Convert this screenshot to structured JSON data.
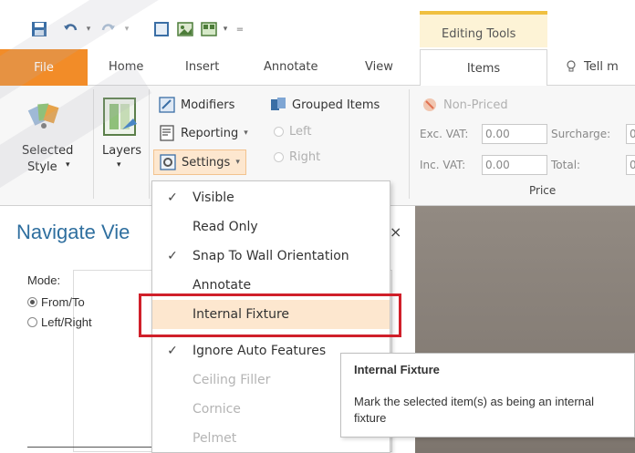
{
  "quick_access": {
    "icons": [
      "save-icon",
      "undo-icon",
      "redo-icon",
      "square-icon",
      "gallery-icon",
      "layout-icon",
      "customize-icon"
    ]
  },
  "context_tab": {
    "label": "Editing Tools"
  },
  "tabs": {
    "file": "File",
    "home": "Home",
    "insert": "Insert",
    "annotate": "Annotate",
    "view": "View",
    "items": "Items",
    "tell_me": "Tell m"
  },
  "ribbon": {
    "selected_style": "Selected",
    "selected_style2": "Style",
    "layers": "Layers",
    "modifiers": "Modifiers",
    "reporting": "Reporting",
    "settings": "Settings",
    "grouped_items": "Grouped Items",
    "left": "Left",
    "right": "Right",
    "non_priced": "Non-Priced",
    "exc_vat_label": "Exc. VAT:",
    "exc_vat_value": "0.00",
    "inc_vat_label": "Inc. VAT:",
    "inc_vat_value": "0.00",
    "surcharge_label": "Surcharge:",
    "surcharge_value": "0",
    "total_label": "Total:",
    "total_value": "0",
    "price_group": "Price"
  },
  "panel": {
    "title": "Navigate Vie",
    "close": "×",
    "mode_label": "Mode:",
    "from_to": "From/To",
    "left_right": "Left/Right"
  },
  "menu": {
    "items": [
      {
        "label": "Visible",
        "checked": true,
        "disabled": false
      },
      {
        "label": "Read Only",
        "checked": false,
        "disabled": false
      },
      {
        "label": "Snap To Wall Orientation",
        "checked": true,
        "disabled": false
      },
      {
        "label": "Annotate",
        "checked": false,
        "disabled": false
      },
      {
        "label": "Internal Fixture",
        "checked": false,
        "disabled": false,
        "hover": true
      },
      {
        "label": "Ignore Auto Features",
        "checked": true,
        "disabled": false
      },
      {
        "label": "Ceiling Filler",
        "checked": false,
        "disabled": true
      },
      {
        "label": "Cornice",
        "checked": false,
        "disabled": true
      },
      {
        "label": "Pelmet",
        "checked": false,
        "disabled": true
      }
    ],
    "check_glyph": "✓"
  },
  "tooltip": {
    "title": "Internal Fixture",
    "body": "Mark the selected item(s) as being an internal fixture"
  },
  "colors": {
    "file_tab": "#f28c28",
    "highlight": "#d0202a",
    "menu_hover": "#fde7cf",
    "title_blue": "#2f6f9f"
  }
}
